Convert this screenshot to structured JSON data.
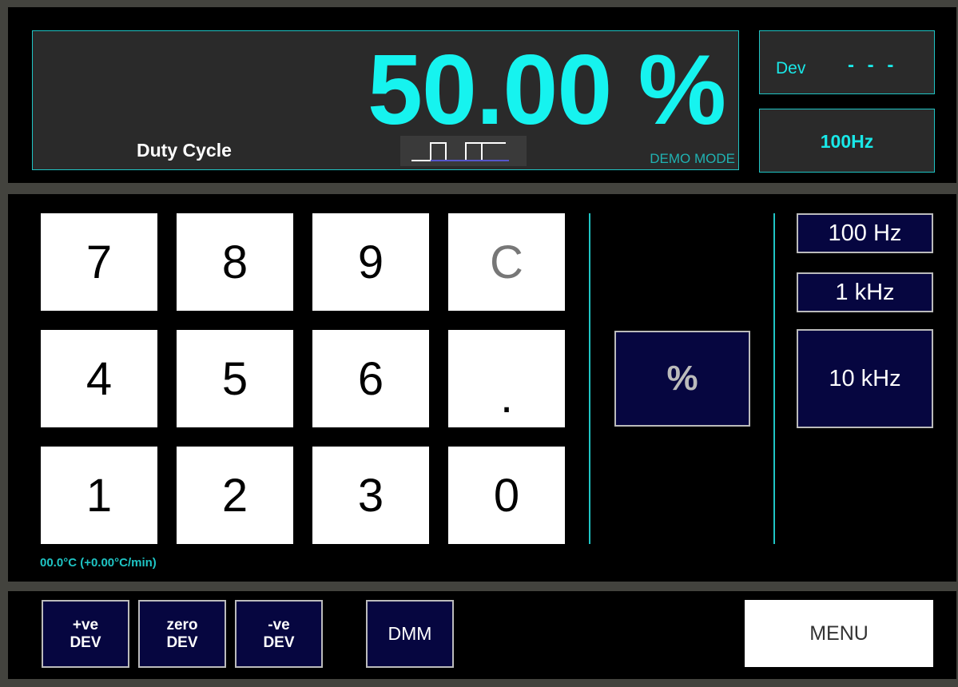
{
  "display": {
    "value": "50.00 %",
    "label": "Duty Cycle",
    "mode": "DEMO MODE"
  },
  "status": {
    "dev_label": "Dev",
    "dev_value": "- - -",
    "frequency": "100Hz"
  },
  "keypad": {
    "keys": [
      "7",
      "8",
      "9",
      "C",
      "4",
      "5",
      "6",
      ".",
      "1",
      "2",
      "3",
      "0"
    ]
  },
  "unit_button": "%",
  "frequency_buttons": [
    "100 Hz",
    "1 kHz",
    "10 kHz"
  ],
  "temperature": "00.0°C (+0.00°C/min)",
  "bottom": {
    "pos_dev": [
      "+ve",
      "DEV"
    ],
    "zero_dev": [
      "zero",
      "DEV"
    ],
    "neg_dev": [
      "-ve",
      "DEV"
    ],
    "dmm": "DMM",
    "menu": "MENU"
  },
  "colors": {
    "accent": "#16f3ef",
    "button_bg": "#060640",
    "panel_bg": "#000000",
    "display_bg": "#2a2a2a"
  },
  "icons": {
    "waveform": "square-wave-icon"
  }
}
